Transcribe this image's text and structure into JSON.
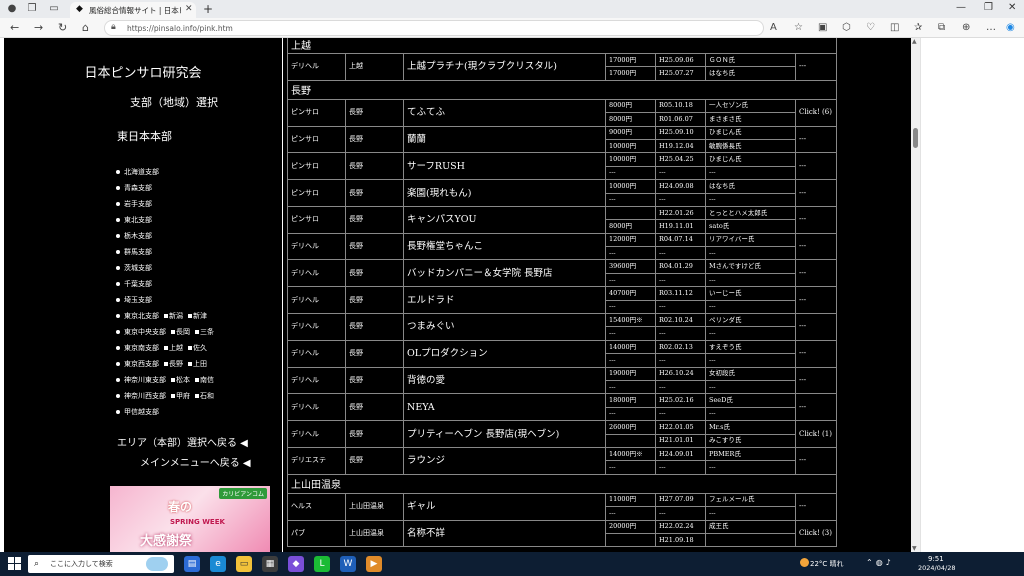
{
  "browser": {
    "tab_title": "風俗総合情報サイト | 日本ピンサロ",
    "url": "https://pinsalo.info/pink.htm",
    "new_tab_icon": "plus-icon"
  },
  "sidebar": {
    "site_title": "日本ピンサロ研究会",
    "branch_heading": "支部（地域）選択",
    "region_heading": "東日本本部",
    "branches": [
      {
        "label": "北海道支部",
        "extra": []
      },
      {
        "label": "青森支部",
        "extra": []
      },
      {
        "label": "岩手支部",
        "extra": []
      },
      {
        "label": "東北支部",
        "extra": []
      },
      {
        "label": "栃木支部",
        "extra": []
      },
      {
        "label": "群馬支部",
        "extra": []
      },
      {
        "label": "茨城支部",
        "extra": []
      },
      {
        "label": "千葉支部",
        "extra": []
      },
      {
        "label": "埼玉支部",
        "extra": []
      },
      {
        "label": "東京北支部",
        "extra": [
          "新潟",
          "新津"
        ]
      },
      {
        "label": "東京中央支部",
        "extra": [
          "長岡",
          "三条"
        ]
      },
      {
        "label": "東京南支部",
        "extra": [
          "上越",
          "佐久"
        ]
      },
      {
        "label": "東京西支部",
        "extra": [
          "長野",
          "上田"
        ]
      },
      {
        "label": "神奈川東支部",
        "extra": [
          "松本",
          "南信"
        ]
      },
      {
        "label": "神奈川西支部",
        "extra": [
          "甲府",
          "石和"
        ]
      },
      {
        "label": "甲信越支部",
        "extra": []
      }
    ],
    "back_area": "エリア（本部）選択へ戻る ◀",
    "back_menu": "メインメニューへ戻る ◀",
    "banner": {
      "badge": "カリビアンコム",
      "line1": "春の",
      "line2": "SPRING WEEK",
      "line3": "大感謝祭"
    }
  },
  "table": {
    "regions": [
      {
        "name": "上越",
        "shops": [
          {
            "type": "デリヘル",
            "area": "上越",
            "name": "上越プラチナ(現クラブクリスタル)",
            "click": "---",
            "reports": [
              {
                "price": "17000円",
                "date": "H25.09.06",
                "reporter": "ＧＯＮ氏"
              },
              {
                "price": "17000円",
                "date": "H25.07.27",
                "reporter": "はなち氏"
              }
            ]
          }
        ]
      },
      {
        "name": "長野",
        "shops": [
          {
            "type": "ピンサロ",
            "area": "長野",
            "name": "てふてふ",
            "click": "Click! (6)",
            "reports": [
              {
                "price": "8000円",
                "date": "R05.10.18",
                "reporter": "一人セゾン氏"
              },
              {
                "price": "8000円",
                "date": "R01.06.07",
                "reporter": "まさまさ氏"
              }
            ]
          },
          {
            "type": "ピンサロ",
            "area": "長野",
            "name": "蘭蘭",
            "click": "---",
            "reports": [
              {
                "price": "9000円",
                "date": "H25.09.10",
                "reporter": "ひまじん氏"
              },
              {
                "price": "10000円",
                "date": "H19.12.04",
                "reporter": "敏腕係長氏"
              }
            ]
          },
          {
            "type": "ピンサロ",
            "area": "長野",
            "name": "サーフRUSH",
            "click": "---",
            "reports": [
              {
                "price": "10000円",
                "date": "H25.04.25",
                "reporter": "ひまじん氏"
              },
              {
                "price": "---",
                "date": "---",
                "reporter": "---"
              }
            ]
          },
          {
            "type": "ピンサロ",
            "area": "長野",
            "name": "楽園(現れもん)",
            "click": "---",
            "reports": [
              {
                "price": "10000円",
                "date": "H24.09.08",
                "reporter": "はなち氏"
              },
              {
                "price": "---",
                "date": "---",
                "reporter": "---"
              }
            ]
          },
          {
            "type": "ピンサロ",
            "area": "長野",
            "name": "キャンパスYOU",
            "click": "---",
            "reports": [
              {
                "price": "",
                "date": "H22.01.26",
                "reporter": "とっととハメ太郎氏"
              },
              {
                "price": "8000円",
                "date": "H19.11.01",
                "reporter": "sato氏"
              }
            ]
          },
          {
            "type": "デリヘル",
            "area": "長野",
            "name": "長野権堂ちゃんこ",
            "click": "---",
            "reports": [
              {
                "price": "12000円",
                "date": "R04.07.14",
                "reporter": "リアワイバー氏"
              },
              {
                "price": "---",
                "date": "---",
                "reporter": "---"
              }
            ]
          },
          {
            "type": "デリヘル",
            "area": "長野",
            "name": "バッドカンパニー＆女学院 長野店",
            "click": "---",
            "reports": [
              {
                "price": "39600円",
                "date": "R04.01.29",
                "reporter": "Mさんですけど氏"
              },
              {
                "price": "---",
                "date": "---",
                "reporter": "---"
              }
            ]
          },
          {
            "type": "デリヘル",
            "area": "長野",
            "name": "エルドラド",
            "click": "---",
            "reports": [
              {
                "price": "40700円",
                "date": "R03.11.12",
                "reporter": "いーじー氏"
              },
              {
                "price": "---",
                "date": "---",
                "reporter": "---"
              }
            ]
          },
          {
            "type": "デリヘル",
            "area": "長野",
            "name": "つまみぐい",
            "click": "---",
            "reports": [
              {
                "price": "15400円※",
                "date": "R02.10.24",
                "reporter": "ペリンダ氏"
              },
              {
                "price": "---",
                "date": "---",
                "reporter": "---"
              }
            ]
          },
          {
            "type": "デリヘル",
            "area": "長野",
            "name": "OLプロダクション",
            "click": "---",
            "reports": [
              {
                "price": "14000円",
                "date": "R02.02.13",
                "reporter": "すえぞう氏"
              },
              {
                "price": "---",
                "date": "---",
                "reporter": "---"
              }
            ]
          },
          {
            "type": "デリヘル",
            "area": "長野",
            "name": "背徳の愛",
            "click": "---",
            "reports": [
              {
                "price": "19000円",
                "date": "H26.10.24",
                "reporter": "女初段氏"
              },
              {
                "price": "---",
                "date": "---",
                "reporter": "---"
              }
            ]
          },
          {
            "type": "デリヘル",
            "area": "長野",
            "name": "NEYA",
            "click": "---",
            "reports": [
              {
                "price": "18000円",
                "date": "H25.02.16",
                "reporter": "SeeD氏"
              },
              {
                "price": "---",
                "date": "---",
                "reporter": "---"
              }
            ]
          },
          {
            "type": "デリヘル",
            "area": "長野",
            "name": "プリティーヘブン 長野店(現ヘブン)",
            "click": "Click! (1)",
            "reports": [
              {
                "price": "26000円",
                "date": "H22.01.05",
                "reporter": "Mr.s氏"
              },
              {
                "price": "",
                "date": "H21.01.01",
                "reporter": "みこすり氏"
              }
            ]
          },
          {
            "type": "デリエステ",
            "area": "長野",
            "name": "ラウンジ",
            "click": "---",
            "reports": [
              {
                "price": "14000円※",
                "date": "H24.09.01",
                "reporter": "PBMER氏"
              },
              {
                "price": "---",
                "date": "---",
                "reporter": "---"
              }
            ]
          }
        ]
      },
      {
        "name": "上山田温泉",
        "shops": [
          {
            "type": "ヘルス",
            "area": "上山田温泉",
            "name": "ギャル",
            "click": "---",
            "reports": [
              {
                "price": "11000円",
                "date": "H27.07.09",
                "reporter": "フェルメール氏"
              },
              {
                "price": "---",
                "date": "---",
                "reporter": "---"
              }
            ]
          },
          {
            "type": "パブ",
            "area": "上山田温泉",
            "name": "名称不詳",
            "click": "Click! (3)",
            "reports": [
              {
                "price": "20000円",
                "date": "H22.02.24",
                "reporter": "成王氏"
              },
              {
                "price": "",
                "date": "H21.09.18",
                "reporter": ""
              }
            ]
          }
        ]
      }
    ]
  },
  "taskbar": {
    "search_placeholder": "ここに入力して検索",
    "weather": "22°C 晴れ",
    "time": "9:51",
    "date": "2024/04/28"
  }
}
